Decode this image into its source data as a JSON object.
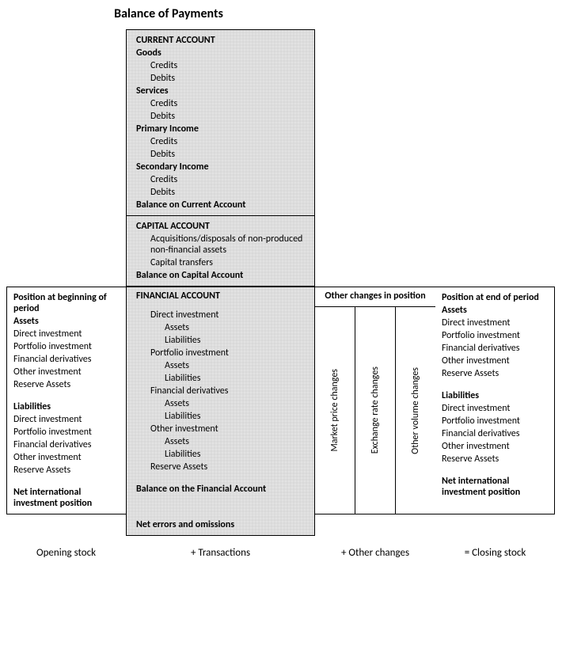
{
  "title": "Balance of Payments",
  "current": {
    "head": "CURRENT ACCOUNT",
    "goods": "Goods",
    "services": "Services",
    "primary": "Primary Income",
    "secondary": "Secondary Income",
    "credits": "Credits",
    "debits": "Debits",
    "balance": "Balance on Current Account"
  },
  "capital": {
    "head": "CAPITAL ACCOUNT",
    "acq": "Acquisitions/disposals of non-produced non-financial assets",
    "transfers": "Capital transfers",
    "balance": "Balance on Capital Account"
  },
  "financial": {
    "head": "FINANCIAL ACCOUNT",
    "direct": "Direct investment",
    "portfolio": "Portfolio investment",
    "derivatives": "Financial derivatives",
    "other": "Other investment",
    "reserve": "Reserve Assets",
    "assets": "Assets",
    "liabilities": "Liabilities",
    "balance": "Balance on the Financial Account"
  },
  "position_start": {
    "head": "Position at beginning of period",
    "assets": "Assets",
    "liabilities": "Liabilities",
    "direct": "Direct investment",
    "portfolio": "Portfolio investment",
    "derivatives": "Financial derivatives",
    "other": "Other investment",
    "reserve": "Reserve Assets",
    "niip": "Net international investment position"
  },
  "position_end": {
    "head": "Position at end of period",
    "assets": "Assets",
    "liabilities": "Liabilities",
    "direct": "Direct investment",
    "portfolio": "Portfolio investment",
    "derivatives": "Financial derivatives",
    "other": "Other investment",
    "reserve": "Reserve Assets",
    "niip": "Net international investment position"
  },
  "other_changes": {
    "head": "Other changes in position",
    "market": "Market price changes",
    "exchange": "Exchange rate changes",
    "volume": "Other volume changes"
  },
  "errors": "Net errors and omissions",
  "footer": {
    "opening": "Opening stock",
    "transactions": "+ Transactions",
    "other": "+ Other changes",
    "closing": "= Closing stock"
  }
}
